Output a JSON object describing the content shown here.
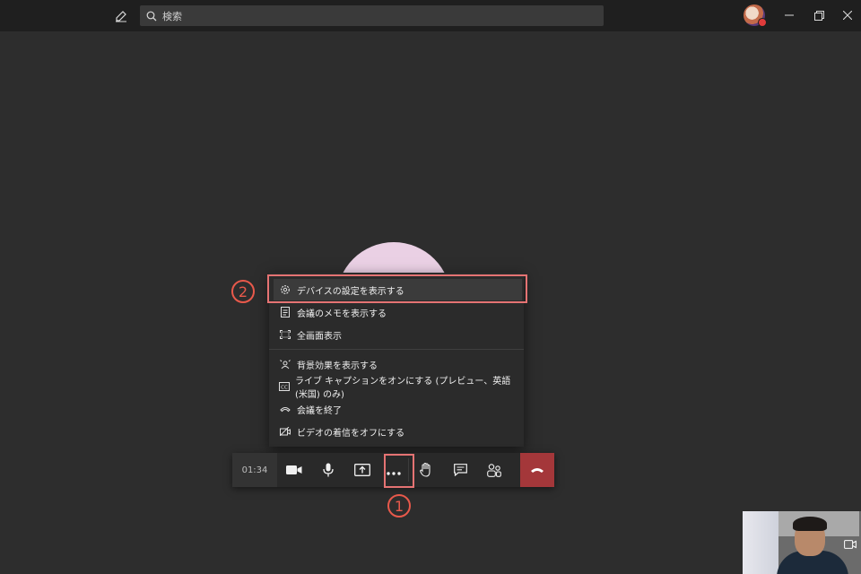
{
  "titlebar": {
    "search_placeholder": "検索"
  },
  "menu": {
    "items": [
      {
        "label": "デバイスの設定を表示する",
        "icon": "gear-icon"
      },
      {
        "label": "会議のメモを表示する",
        "icon": "notes-icon"
      },
      {
        "label": "全画面表示",
        "icon": "fullscreen-icon"
      },
      {
        "label": "背景効果を表示する",
        "icon": "background-effects-icon"
      },
      {
        "label": "ライブ キャプションをオンにする (プレビュー、英語 (米国) のみ)",
        "icon": "cc-icon"
      },
      {
        "label": "会議を終了",
        "icon": "end-meeting-icon"
      },
      {
        "label": "ビデオの着信をオフにする",
        "icon": "video-off-icon"
      }
    ]
  },
  "annotations": {
    "step1": "1",
    "step2": "2",
    "color": "#e8594b"
  },
  "toolbar": {
    "timer": "01:34",
    "hangup_color": "#a4373a"
  }
}
